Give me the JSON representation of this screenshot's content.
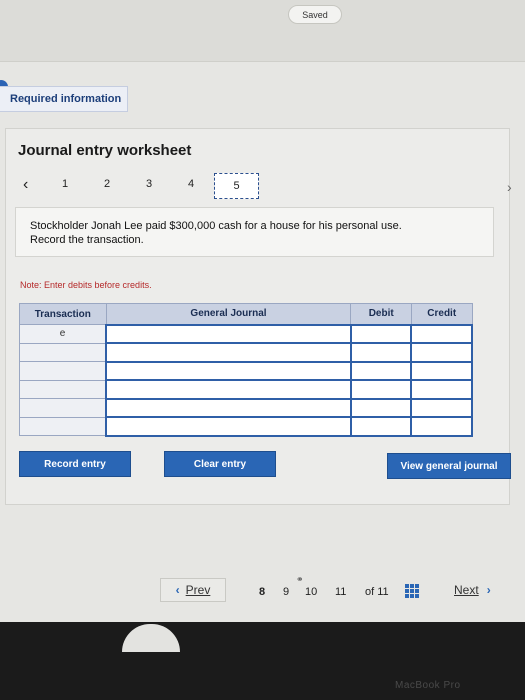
{
  "status": {
    "saved": "Saved"
  },
  "section": {
    "required": "Required information"
  },
  "worksheet": {
    "title": "Journal entry worksheet",
    "steps": [
      "1",
      "2",
      "3",
      "4",
      "5"
    ],
    "active_step": "5",
    "question_line1": "Stockholder Jonah Lee paid $300,000 cash for a house for his personal use.",
    "question_line2": "Record the transaction.",
    "note": "Note: Enter debits before credits."
  },
  "table": {
    "headers": {
      "transaction": "Transaction",
      "general_journal": "General Journal",
      "debit": "Debit",
      "credit": "Credit"
    },
    "rows": [
      {
        "transaction": "e",
        "account": "",
        "debit": "",
        "credit": ""
      },
      {
        "transaction": "",
        "account": "",
        "debit": "",
        "credit": ""
      },
      {
        "transaction": "",
        "account": "",
        "debit": "",
        "credit": ""
      },
      {
        "transaction": "",
        "account": "",
        "debit": "",
        "credit": ""
      },
      {
        "transaction": "",
        "account": "",
        "debit": "",
        "credit": ""
      },
      {
        "transaction": "",
        "account": "",
        "debit": "",
        "credit": ""
      }
    ]
  },
  "buttons": {
    "record_entry": "Record entry",
    "clear_entry": "Clear entry",
    "view_general_journal": "View general journal"
  },
  "pagination": {
    "prev": "Prev",
    "pages": [
      "8",
      "9",
      "10",
      "11"
    ],
    "current_page": "8",
    "of_total": "of 11",
    "next": "Next"
  },
  "device": {
    "watermark": "MacBook Pro"
  },
  "colors": {
    "accent": "#2a66b5",
    "note_red": "#b5292a",
    "header_bg": "#c9d1e2"
  }
}
